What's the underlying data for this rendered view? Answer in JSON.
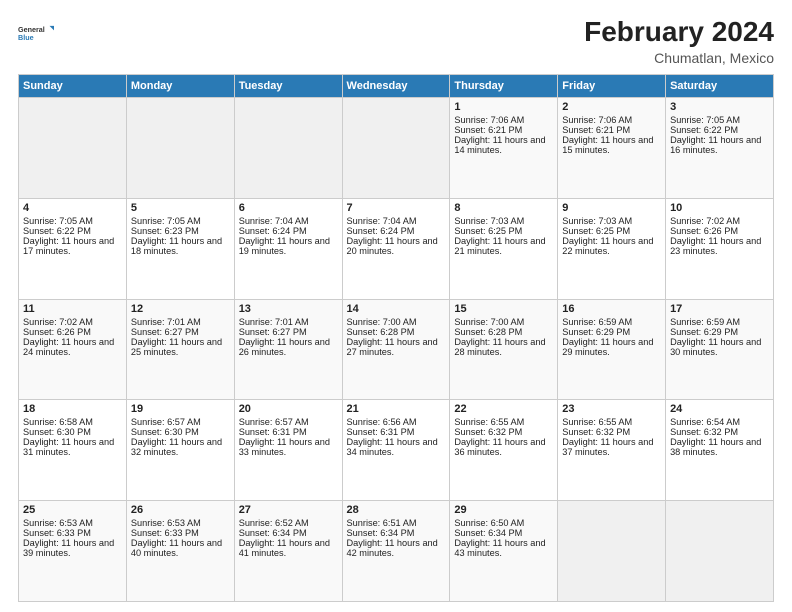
{
  "header": {
    "logo_line1": "General",
    "logo_line2": "Blue",
    "title": "February 2024",
    "subtitle": "Chumatlan, Mexico"
  },
  "days_of_week": [
    "Sunday",
    "Monday",
    "Tuesday",
    "Wednesday",
    "Thursday",
    "Friday",
    "Saturday"
  ],
  "weeks": [
    [
      {
        "day": "",
        "info": ""
      },
      {
        "day": "",
        "info": ""
      },
      {
        "day": "",
        "info": ""
      },
      {
        "day": "",
        "info": ""
      },
      {
        "day": "1",
        "info": "Sunrise: 7:06 AM\nSunset: 6:21 PM\nDaylight: 11 hours and 14 minutes."
      },
      {
        "day": "2",
        "info": "Sunrise: 7:06 AM\nSunset: 6:21 PM\nDaylight: 11 hours and 15 minutes."
      },
      {
        "day": "3",
        "info": "Sunrise: 7:05 AM\nSunset: 6:22 PM\nDaylight: 11 hours and 16 minutes."
      }
    ],
    [
      {
        "day": "4",
        "info": "Sunrise: 7:05 AM\nSunset: 6:22 PM\nDaylight: 11 hours and 17 minutes."
      },
      {
        "day": "5",
        "info": "Sunrise: 7:05 AM\nSunset: 6:23 PM\nDaylight: 11 hours and 18 minutes."
      },
      {
        "day": "6",
        "info": "Sunrise: 7:04 AM\nSunset: 6:24 PM\nDaylight: 11 hours and 19 minutes."
      },
      {
        "day": "7",
        "info": "Sunrise: 7:04 AM\nSunset: 6:24 PM\nDaylight: 11 hours and 20 minutes."
      },
      {
        "day": "8",
        "info": "Sunrise: 7:03 AM\nSunset: 6:25 PM\nDaylight: 11 hours and 21 minutes."
      },
      {
        "day": "9",
        "info": "Sunrise: 7:03 AM\nSunset: 6:25 PM\nDaylight: 11 hours and 22 minutes."
      },
      {
        "day": "10",
        "info": "Sunrise: 7:02 AM\nSunset: 6:26 PM\nDaylight: 11 hours and 23 minutes."
      }
    ],
    [
      {
        "day": "11",
        "info": "Sunrise: 7:02 AM\nSunset: 6:26 PM\nDaylight: 11 hours and 24 minutes."
      },
      {
        "day": "12",
        "info": "Sunrise: 7:01 AM\nSunset: 6:27 PM\nDaylight: 11 hours and 25 minutes."
      },
      {
        "day": "13",
        "info": "Sunrise: 7:01 AM\nSunset: 6:27 PM\nDaylight: 11 hours and 26 minutes."
      },
      {
        "day": "14",
        "info": "Sunrise: 7:00 AM\nSunset: 6:28 PM\nDaylight: 11 hours and 27 minutes."
      },
      {
        "day": "15",
        "info": "Sunrise: 7:00 AM\nSunset: 6:28 PM\nDaylight: 11 hours and 28 minutes."
      },
      {
        "day": "16",
        "info": "Sunrise: 6:59 AM\nSunset: 6:29 PM\nDaylight: 11 hours and 29 minutes."
      },
      {
        "day": "17",
        "info": "Sunrise: 6:59 AM\nSunset: 6:29 PM\nDaylight: 11 hours and 30 minutes."
      }
    ],
    [
      {
        "day": "18",
        "info": "Sunrise: 6:58 AM\nSunset: 6:30 PM\nDaylight: 11 hours and 31 minutes."
      },
      {
        "day": "19",
        "info": "Sunrise: 6:57 AM\nSunset: 6:30 PM\nDaylight: 11 hours and 32 minutes."
      },
      {
        "day": "20",
        "info": "Sunrise: 6:57 AM\nSunset: 6:31 PM\nDaylight: 11 hours and 33 minutes."
      },
      {
        "day": "21",
        "info": "Sunrise: 6:56 AM\nSunset: 6:31 PM\nDaylight: 11 hours and 34 minutes."
      },
      {
        "day": "22",
        "info": "Sunrise: 6:55 AM\nSunset: 6:32 PM\nDaylight: 11 hours and 36 minutes."
      },
      {
        "day": "23",
        "info": "Sunrise: 6:55 AM\nSunset: 6:32 PM\nDaylight: 11 hours and 37 minutes."
      },
      {
        "day": "24",
        "info": "Sunrise: 6:54 AM\nSunset: 6:32 PM\nDaylight: 11 hours and 38 minutes."
      }
    ],
    [
      {
        "day": "25",
        "info": "Sunrise: 6:53 AM\nSunset: 6:33 PM\nDaylight: 11 hours and 39 minutes."
      },
      {
        "day": "26",
        "info": "Sunrise: 6:53 AM\nSunset: 6:33 PM\nDaylight: 11 hours and 40 minutes."
      },
      {
        "day": "27",
        "info": "Sunrise: 6:52 AM\nSunset: 6:34 PM\nDaylight: 11 hours and 41 minutes."
      },
      {
        "day": "28",
        "info": "Sunrise: 6:51 AM\nSunset: 6:34 PM\nDaylight: 11 hours and 42 minutes."
      },
      {
        "day": "29",
        "info": "Sunrise: 6:50 AM\nSunset: 6:34 PM\nDaylight: 11 hours and 43 minutes."
      },
      {
        "day": "",
        "info": ""
      },
      {
        "day": "",
        "info": ""
      }
    ]
  ]
}
